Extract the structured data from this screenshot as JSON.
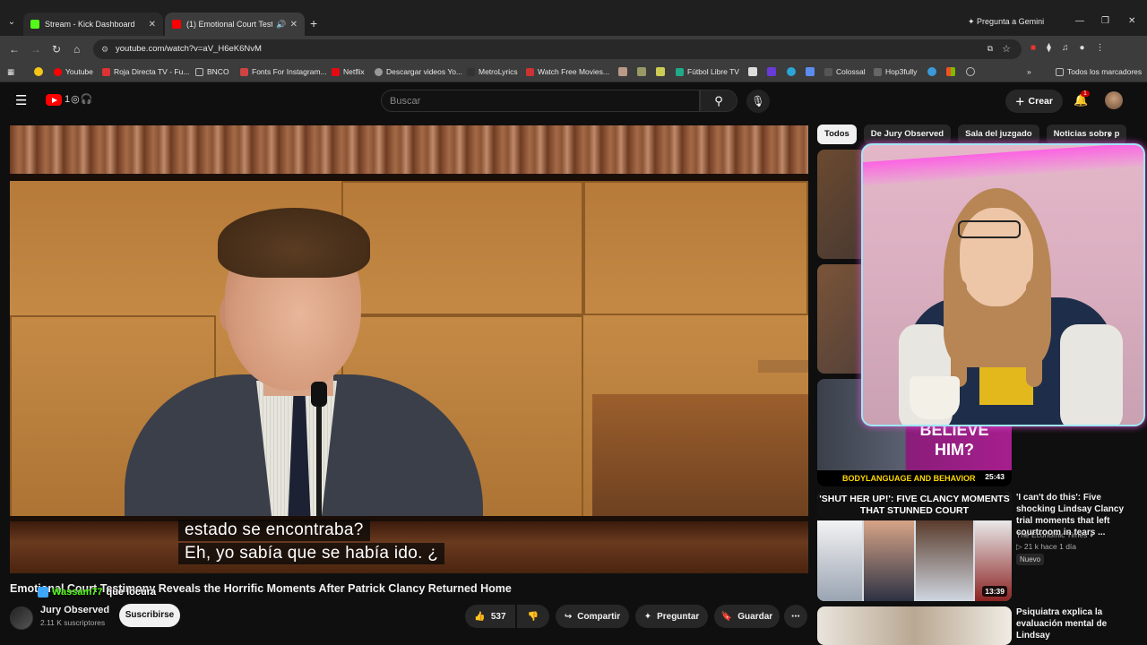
{
  "browser": {
    "tabs": [
      {
        "title": "Stream - Kick Dashboard",
        "favicon_color": "#53fc18"
      },
      {
        "title": "(1) Emotional Court Testimo",
        "favicon_color": "#ff0000"
      }
    ],
    "gemini": "Pregunta a Gemini",
    "url": "youtube.com/watch?v=aV_H6eK6NvM",
    "bookmarks": [
      {
        "label": "Youtube",
        "color": "#ff0000"
      },
      {
        "label": "Roja Directa TV - Fu...",
        "color": "#d33"
      },
      {
        "label": "BNCO",
        "color": "#888"
      },
      {
        "label": "Fonts For Instagram...",
        "color": "#c44"
      },
      {
        "label": "Netflix",
        "color": "#e50914"
      },
      {
        "label": "Descargar videos Yo...",
        "color": "#999"
      },
      {
        "label": "MetroLyrics",
        "color": "#333"
      },
      {
        "label": "Watch Free Movies...",
        "color": "#c33"
      },
      {
        "label": "Fútbol Libre TV",
        "color": "#2a8"
      },
      {
        "label": "Colossal",
        "color": "#555"
      },
      {
        "label": "Hop3fully",
        "color": "#666"
      }
    ],
    "all_bookmarks": "Todos los marcadores"
  },
  "masthead": {
    "search_placeholder": "Buscar",
    "create_label": "Crear",
    "notifications": "1"
  },
  "video": {
    "captions": [
      "estado se encontraba?",
      "Eh, yo sabía que se había ido.  ¿"
    ],
    "title": "Emotional Court Testimony Reveals the Horrific Moments After Patrick Clancy Returned Home",
    "stream_chat": {
      "user": "Wassam77",
      "message": "que locura"
    },
    "channel": "Jury Observed",
    "subscribers": "2.11 K suscriptores",
    "subscribe": "Suscribirse",
    "likes": "537",
    "share": "Compartir",
    "ask": "Preguntar",
    "save": "Guardar"
  },
  "sidebar": {
    "chips": [
      "Todos",
      "De Jury Observed",
      "Sala del juzgado",
      "Noticias sobre p"
    ],
    "thumb3": {
      "line1": "BELIEVE",
      "line2": "HIM?",
      "bottom": "BODYLANGUAGE AND BEHAVIOR",
      "duration": "25:43"
    },
    "rec1": {
      "thumb_text": "'SHUT HER UP!': FIVE CLANCY MOMENTS THAT STUNNED COURT",
      "duration": "13:39",
      "title": "'I can't do this': Five shocking Lindsay Clancy trial moments that left courtroom in tears ...",
      "channel": "The Economic Times",
      "stats": "▷ 21 k   hace 1 día",
      "badge": "Nuevo"
    },
    "rec2": {
      "title": "Psiquiatra explica la evaluación mental de Lindsay"
    }
  }
}
